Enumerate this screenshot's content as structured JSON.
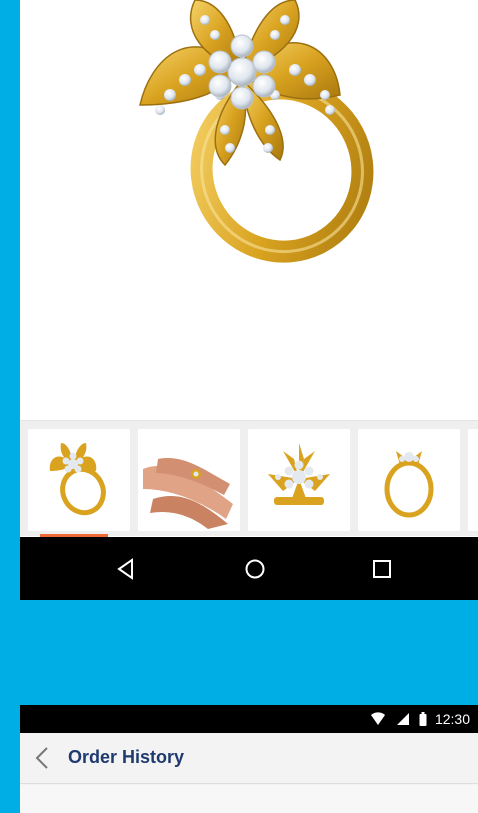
{
  "product_view": {
    "hero_image": "flower-diamond-ring-image",
    "thumbnails": [
      {
        "image": "flower-ring-angle-view",
        "active": true
      },
      {
        "image": "ring-on-hand-view",
        "active": false
      },
      {
        "image": "ring-top-view",
        "active": false
      },
      {
        "image": "ring-side-view",
        "active": false
      }
    ],
    "active_indicator_color": "#ef6a36"
  },
  "nav_bar": {
    "back_icon": "triangle-back-icon",
    "home_icon": "circle-home-icon",
    "recents_icon": "square-recents-icon"
  },
  "status_bar": {
    "time": "12:30",
    "icons": [
      "wifi-icon",
      "signal-icon",
      "battery-icon"
    ]
  },
  "header": {
    "back_icon": "chevron-left-icon",
    "title": "Order History"
  },
  "colors": {
    "background": "#00aee6",
    "title": "#1f3a6e",
    "gold": "#d9a320",
    "diamond": "#e9eef4"
  }
}
